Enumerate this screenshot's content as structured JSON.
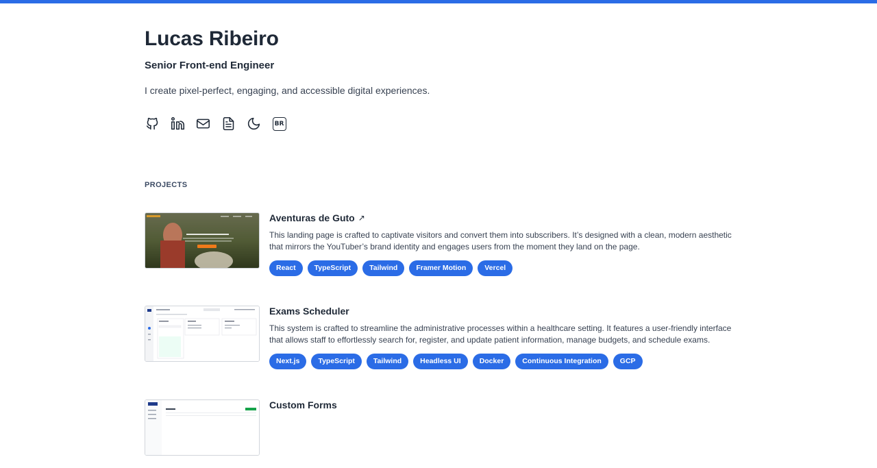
{
  "header": {
    "name": "Lucas Ribeiro",
    "role": "Senior Front-end Engineer",
    "tagline": "I create pixel-perfect, engaging, and accessible digital experiences.",
    "socials": [
      {
        "icon": "github-icon"
      },
      {
        "icon": "linkedin-icon"
      },
      {
        "icon": "mail-icon"
      },
      {
        "icon": "document-icon"
      },
      {
        "icon": "moon-icon"
      },
      {
        "icon": "language-icon",
        "label": "BR"
      }
    ]
  },
  "projects_section": {
    "title": "PROJECTS",
    "items": [
      {
        "title": "Aventuras de Guto",
        "arrow": "↗",
        "description": "This landing page is crafted to captivate visitors and convert them into subscribers. It’s designed with a clean, modern aesthetic that mirrors the YouTuber’s brand identity and engages users from the moment they land on the page.",
        "tags": [
          "React",
          "TypeScript",
          "Tailwind",
          "Framer Motion",
          "Vercel"
        ]
      },
      {
        "title": "Exams Scheduler",
        "description": "This system is crafted to streamline the administrative processes within a healthcare setting. It features a user-friendly interface that allows staff to effortlessly search for, register, and update patient information, manage budgets, and schedule exams.",
        "tags": [
          "Next.js",
          "TypeScript",
          "Tailwind",
          "Headless UI",
          "Docker",
          "Continuous Integration",
          "GCP"
        ]
      },
      {
        "title": "Custom Forms",
        "description": "",
        "tags": []
      }
    ]
  },
  "colors": {
    "accent": "#2b6ce6",
    "text": "#1f2937"
  }
}
